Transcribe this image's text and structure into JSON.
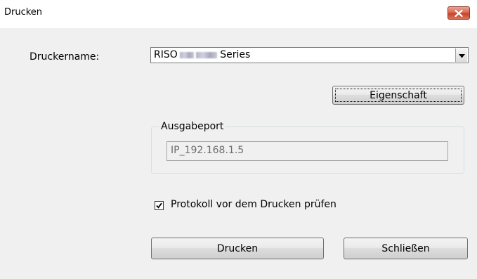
{
  "window": {
    "title": "Drucken"
  },
  "icons": {
    "close": "close-icon",
    "dropdown": "chevron-down-icon",
    "check": "checkmark-icon"
  },
  "colors": {
    "close_button": "#c5432a",
    "background": "#f0f0f0"
  },
  "printer": {
    "label": "Druckername:",
    "selected_prefix": "RISO",
    "selected_suffix": "Series"
  },
  "properties_button": "Eigenschaft",
  "output_port": {
    "legend": "Ausgabeport",
    "value": "IP_192.168.1.5"
  },
  "checkbox": {
    "label": "Protokoll vor dem Drucken prüfen",
    "checked": true
  },
  "buttons": {
    "print": "Drucken",
    "close": "Schließen"
  }
}
